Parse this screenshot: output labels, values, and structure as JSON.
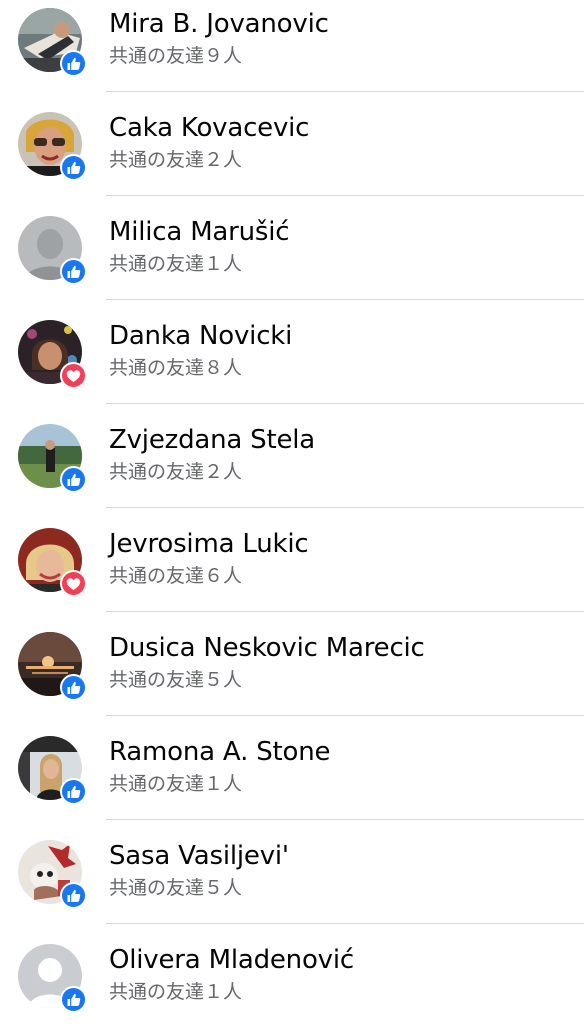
{
  "reactions_list": {
    "people": [
      {
        "name": "Mira B. Jovanovic",
        "mutual_friends": "共通の友達９人",
        "reaction": "like-icon",
        "avatar": "photo-avatar"
      },
      {
        "name": "Caka Kovacevic",
        "mutual_friends": "共通の友達２人",
        "reaction": "like-icon",
        "avatar": "photo-avatar"
      },
      {
        "name": "Milica Marušić",
        "mutual_friends": "共通の友達１人",
        "reaction": "like-icon",
        "avatar": "photo-avatar"
      },
      {
        "name": "Danka Novicki",
        "mutual_friends": "共通の友達８人",
        "reaction": "love-icon",
        "avatar": "photo-avatar"
      },
      {
        "name": "Zvjezdana Stela",
        "mutual_friends": "共通の友達２人",
        "reaction": "like-icon",
        "avatar": "photo-avatar"
      },
      {
        "name": "Jevrosima Lukic",
        "mutual_friends": "共通の友達６人",
        "reaction": "love-icon",
        "avatar": "photo-avatar"
      },
      {
        "name": "Dusica Neskovic Marecic",
        "mutual_friends": "共通の友達５人",
        "reaction": "like-icon",
        "avatar": "photo-avatar"
      },
      {
        "name": "Ramona A. Stone",
        "mutual_friends": "共通の友達１人",
        "reaction": "like-icon",
        "avatar": "photo-avatar"
      },
      {
        "name": "Sasa Vasiljevi'",
        "mutual_friends": "共通の友達５人",
        "reaction": "like-icon",
        "avatar": "photo-avatar"
      },
      {
        "name": "Olivera Mladenović",
        "mutual_friends": "共通の友達１人",
        "reaction": "like-icon",
        "avatar": "default-avatar"
      }
    ]
  },
  "colors": {
    "like_blue": "#1877f2",
    "love_red": "#f33e58",
    "name_text": "#050505",
    "secondary_text": "#65676b",
    "divider": "#d6d7d9"
  }
}
